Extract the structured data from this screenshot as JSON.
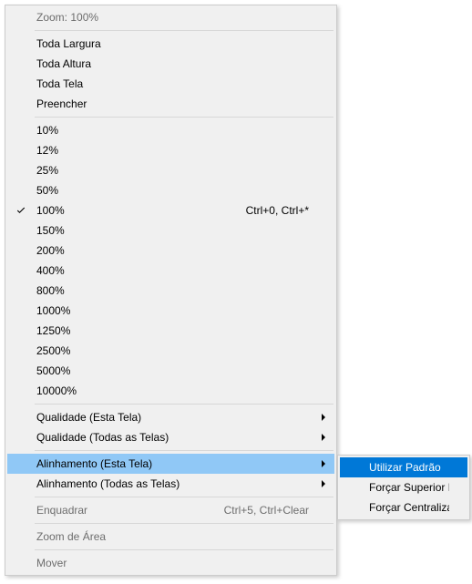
{
  "main_menu": {
    "header": "Zoom: 100%",
    "fit_items": [
      {
        "label": "Toda Largura"
      },
      {
        "label": "Toda Altura"
      },
      {
        "label": "Toda Tela"
      },
      {
        "label": "Preencher"
      }
    ],
    "zoom_items": [
      {
        "label": "10%"
      },
      {
        "label": "12%"
      },
      {
        "label": "25%"
      },
      {
        "label": "50%"
      },
      {
        "label": "100%",
        "checked": true,
        "shortcut": "Ctrl+0, Ctrl+*"
      },
      {
        "label": "150%"
      },
      {
        "label": "200%"
      },
      {
        "label": "400%"
      },
      {
        "label": "800%"
      },
      {
        "label": "1000%"
      },
      {
        "label": "1250%"
      },
      {
        "label": "2500%"
      },
      {
        "label": "5000%"
      },
      {
        "label": "10000%"
      }
    ],
    "quality_items": [
      {
        "label": "Qualidade (Esta Tela)",
        "has_submenu": true
      },
      {
        "label": "Qualidade (Todas as Telas)",
        "has_submenu": true
      }
    ],
    "align_items": [
      {
        "label": "Alinhamento (Esta Tela)",
        "has_submenu": true,
        "hovered": true
      },
      {
        "label": "Alinhamento (Todas as Telas)",
        "has_submenu": true
      }
    ],
    "frame_items": [
      {
        "label": "Enquadrar",
        "disabled": true,
        "shortcut": "Ctrl+5, Ctrl+Clear"
      }
    ],
    "zoom_area_items": [
      {
        "label": "Zoom de Área",
        "disabled": true
      }
    ],
    "move_items": [
      {
        "label": "Mover",
        "disabled": true
      }
    ]
  },
  "submenu": {
    "items": [
      {
        "label": "Utilizar Padrão",
        "highlighted": true
      },
      {
        "label": "Forçar Superior Esquerdo"
      },
      {
        "label": "Forçar Centralizado"
      }
    ]
  }
}
